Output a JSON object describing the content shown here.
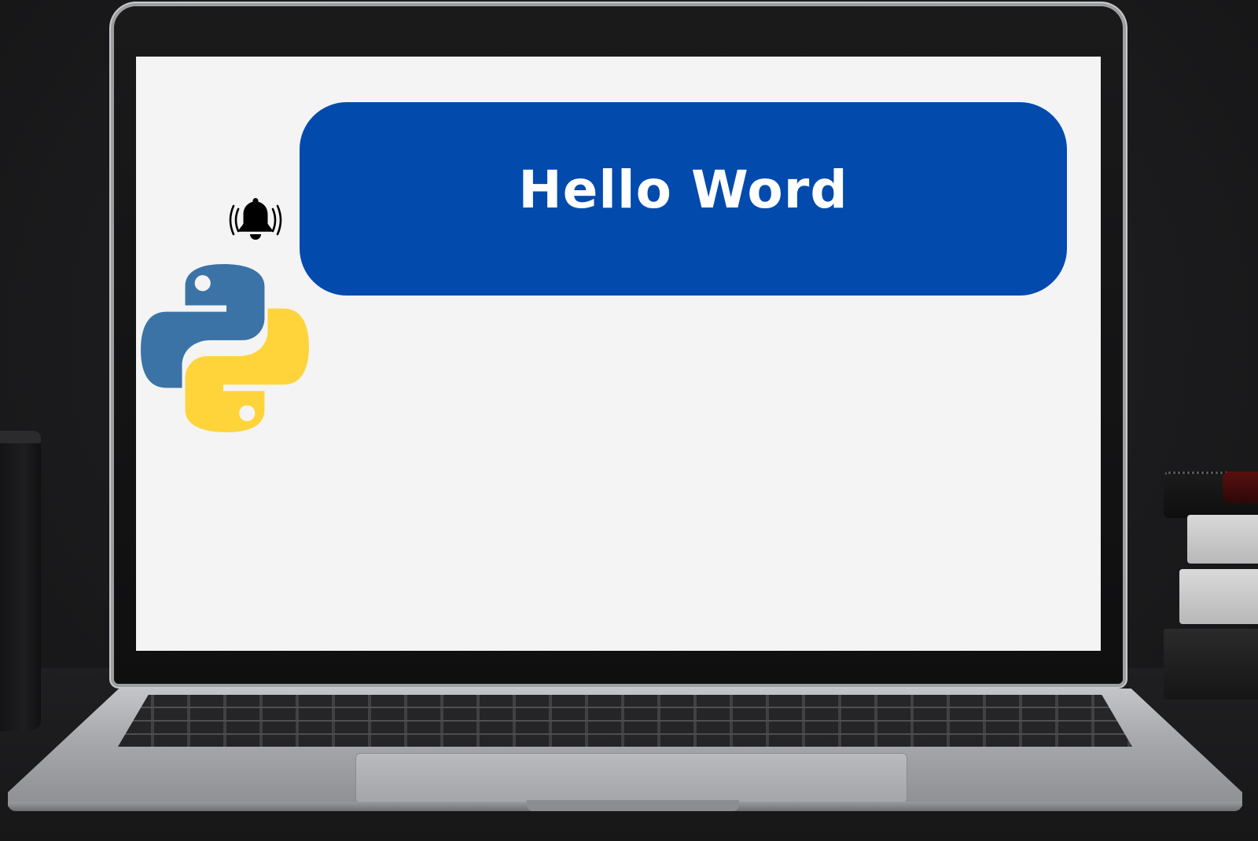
{
  "slide": {
    "title": "Hello Word"
  },
  "icons": {
    "notification": "bell-ringing-icon",
    "logo": "python-logo-icon"
  },
  "colors": {
    "banner": "#034aad",
    "python_blue": "#3b73a6",
    "python_yellow": "#ffd43b",
    "screen_bg": "#f4f4f4"
  }
}
